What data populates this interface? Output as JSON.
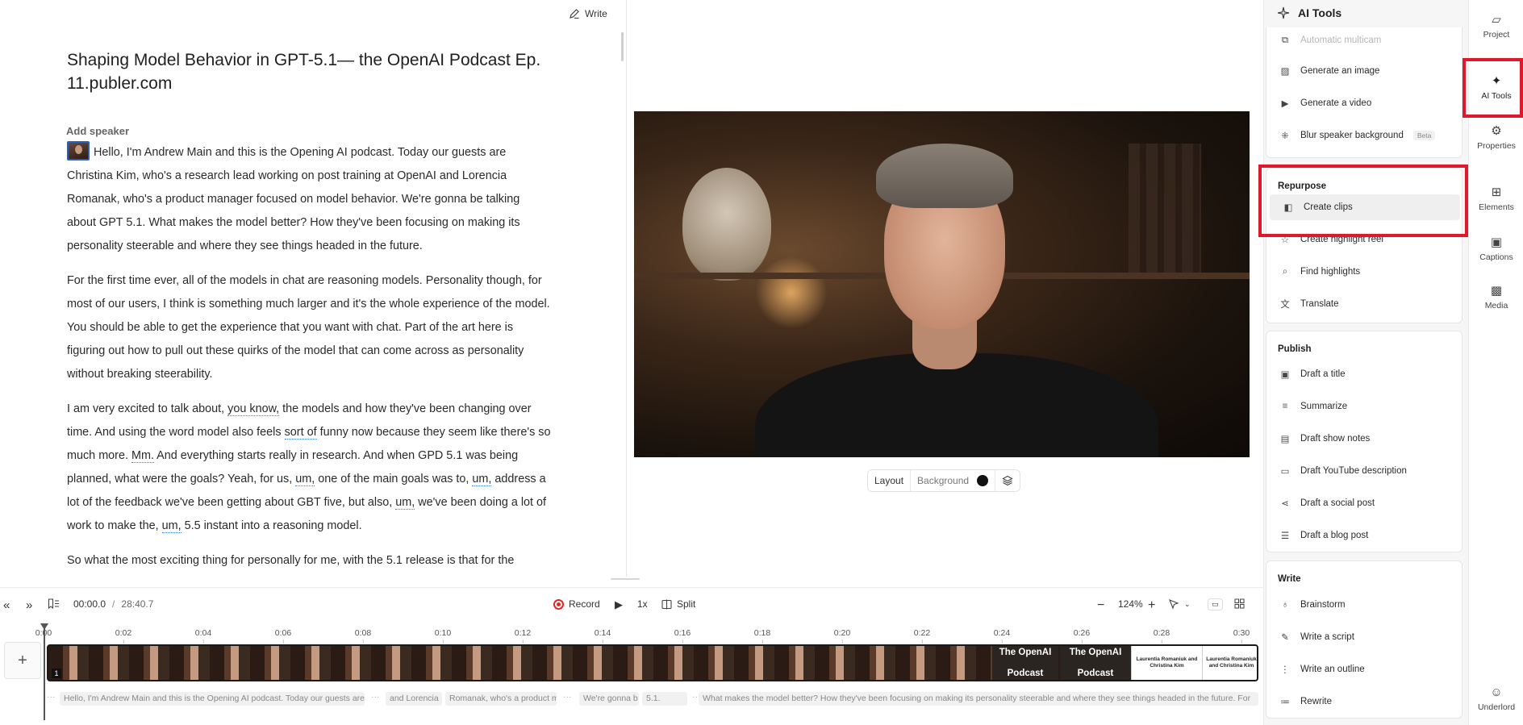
{
  "editor": {
    "write_label": "Write",
    "title": "Shaping Model Behavior in GPT-5.1— the OpenAI Podcast Ep. 11.publer.com",
    "add_speaker": "Add speaker",
    "paragraphs": {
      "p1": "Hello, I'm Andrew Main and this is the Opening AI podcast. Today our guests are Christina Kim, who's a research lead working on post training at OpenAI and Lorencia Romanak, who's a product manager focused on model behavior. We're gonna be talking about GPT 5.1. What makes the model better? How they've been focusing on making its personality steerable and where they see things headed in the future.",
      "p2": "For the first time ever, all of the models in chat are reasoning models. Personality though, for most of our users, I think is something much larger and it's the whole experience of the model. You should be able to get the experience that you want with chat. Part of the art here is figuring out how to pull out these quirks of the model that can come across as personality without breaking steerability.",
      "p3": {
        "a": "I am very excited to talk about, ",
        "f1": "you know,",
        "b": " the models and how they've been changing over time. And using the word model also feels ",
        "f2": "sort of",
        "c": " funny now because they seem like there's so much more. ",
        "f3": "Mm.",
        "d": " And everything starts really in research. And when GPD 5.1 was being planned, what were the goals? Yeah, for us, ",
        "f4": "um,",
        "e": " one of the main goals was to, ",
        "f5": "um,",
        "f": " address a lot of the feedback we've been getting about GBT five, but also, ",
        "f6": "um,",
        "g": " we've been doing a lot of work to make the, ",
        "f7": "um,",
        "h": " 5.5 instant into a reasoning model."
      },
      "p4": "So what the most exciting thing for personally for me, with the 5.1 release is that for the"
    }
  },
  "video_controls": {
    "layout": "Layout",
    "background": "Background",
    "bg_color": "#111111"
  },
  "timeline": {
    "current_time": "00:00.0",
    "separator": "/",
    "total_time": "28:40.7",
    "record": "Record",
    "speed": "1x",
    "split": "Split",
    "zoom": "124%",
    "ruler": [
      "0:00",
      "0:02",
      "0:04",
      "0:06",
      "0:08",
      "0:10",
      "0:12",
      "0:14",
      "0:16",
      "0:18",
      "0:20",
      "0:22",
      "0:24",
      "0:26",
      "0:28",
      "0:30"
    ],
    "clip_number": "1",
    "title_card_top": "The OpenAI",
    "title_card_bottom": "Podcast",
    "name_card": "Laurentia Romaniuk and Christina Kim",
    "captions": {
      "c1": "Hello, I'm Andrew Main and this is the Opening AI podcast. Today our guests are",
      "c2": "and Lorencia",
      "c3": "Romanak, who's a product ma",
      "c4": "We're gonna b",
      "c5": "5.1.",
      "c6": "What makes the model better? How they've been focusing on making its personality steerable and where they see things headed in the future. For"
    },
    "ellipsis": "···"
  },
  "ai_panel": {
    "title": "AI Tools",
    "create": [
      {
        "label": "Automatic multicam",
        "icon": "multicam-icon"
      },
      {
        "label": "Generate an image",
        "icon": "image-sparkle-icon"
      },
      {
        "label": "Generate a video",
        "icon": "video-sparkle-icon"
      },
      {
        "label": "Blur speaker background",
        "icon": "blur-icon",
        "badge": "Beta"
      }
    ],
    "repurpose_title": "Repurpose",
    "repurpose": [
      {
        "label": "Create clips",
        "icon": "clips-icon"
      },
      {
        "label": "Create highlight reel",
        "icon": "star-icon"
      },
      {
        "label": "Find highlights",
        "icon": "search-icon"
      },
      {
        "label": "Translate",
        "icon": "translate-icon"
      }
    ],
    "publish_title": "Publish",
    "publish": [
      {
        "label": "Draft a title",
        "icon": "title-icon"
      },
      {
        "label": "Summarize",
        "icon": "lines-icon"
      },
      {
        "label": "Draft show notes",
        "icon": "document-icon"
      },
      {
        "label": "Draft YouTube description",
        "icon": "monitor-icon"
      },
      {
        "label": "Draft a social post",
        "icon": "share-icon"
      },
      {
        "label": "Draft a blog post",
        "icon": "indent-icon"
      }
    ],
    "write_title": "Write",
    "write": [
      {
        "label": "Brainstorm",
        "icon": "bulb-icon"
      },
      {
        "label": "Write a script",
        "icon": "pen-icon"
      },
      {
        "label": "Write an outline",
        "icon": "list-icon"
      },
      {
        "label": "Rewrite",
        "icon": "rewrite-icon"
      }
    ]
  },
  "rail": {
    "project": "Project",
    "ai_tools": "AI Tools",
    "properties": "Properties",
    "elements": "Elements",
    "captions": "Captions",
    "media": "Media",
    "underlord": "Underlord"
  },
  "colors": {
    "highlight": "#e0182b",
    "accent": "#2d5fb8",
    "filler_underline": "#3a7bd5"
  }
}
